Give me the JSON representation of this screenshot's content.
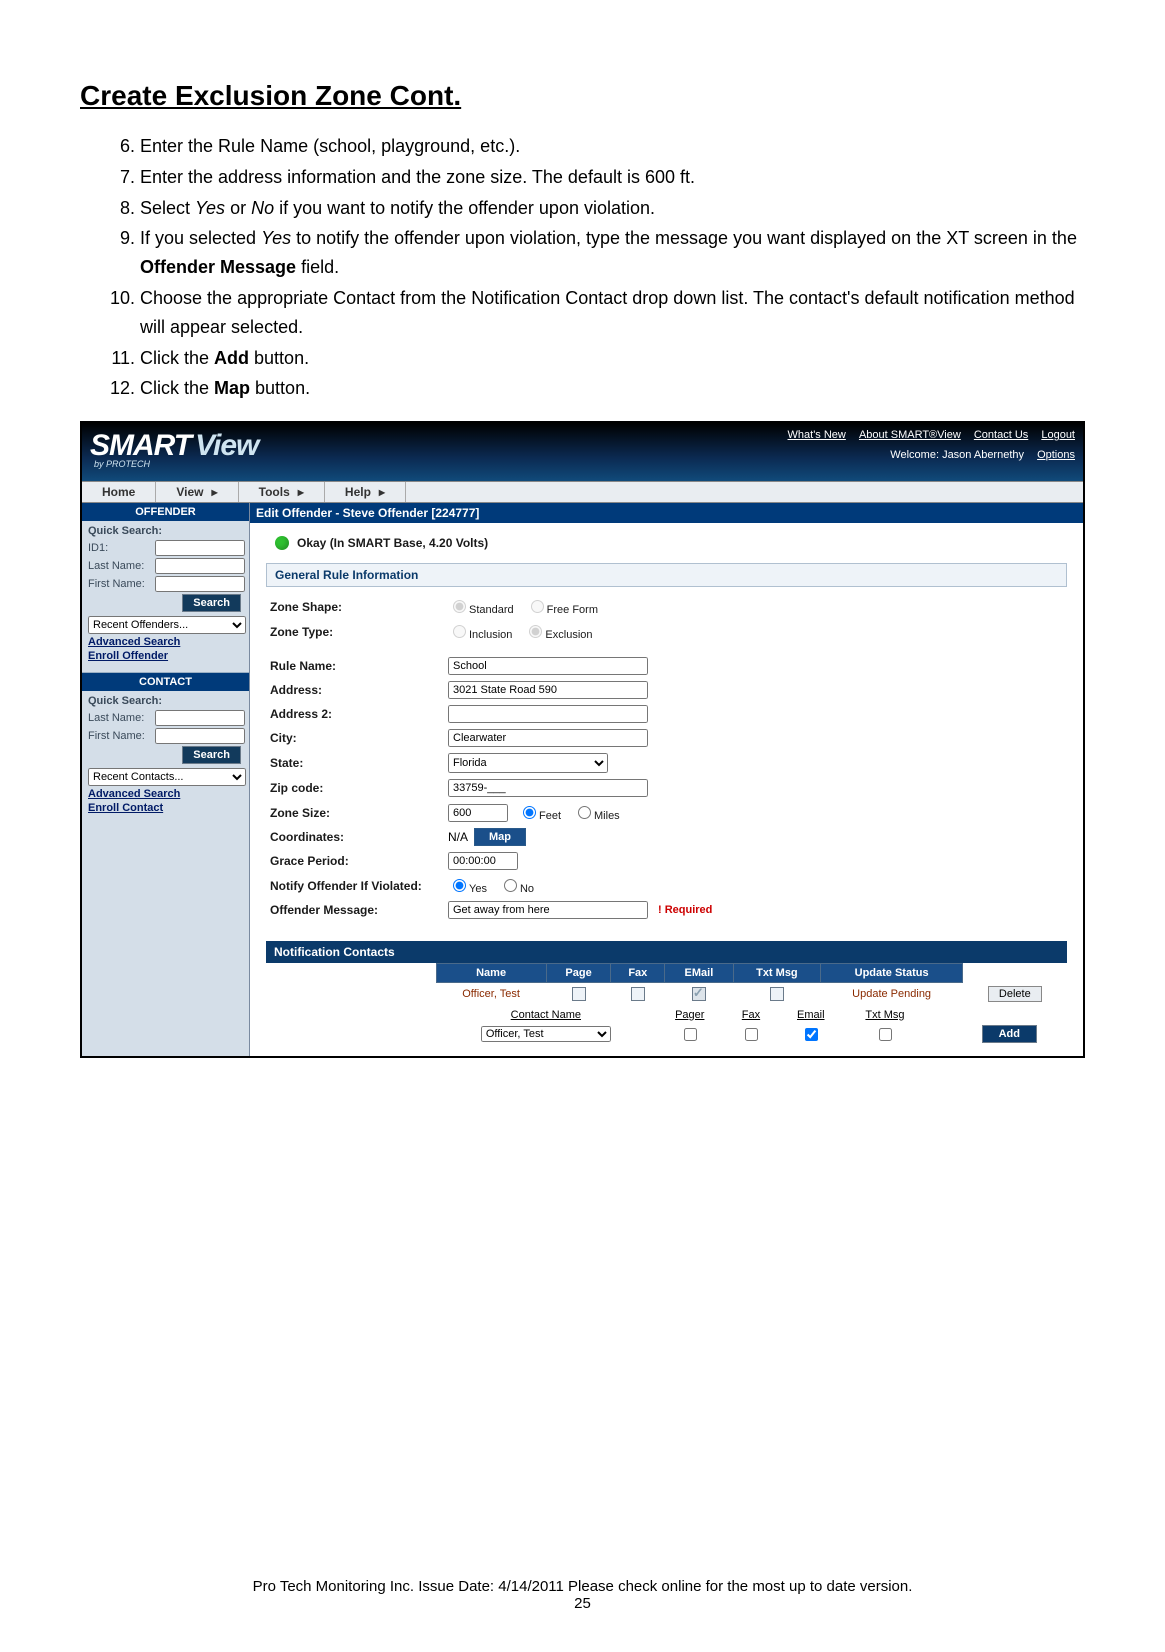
{
  "doc": {
    "title": "Create Exclusion Zone Cont.",
    "steps_start": 6,
    "steps": [
      "Enter the Rule Name (school, playground, etc.).",
      "Enter the address information and the zone size. The default is 600 ft.",
      "Select <i>Yes</i> or <i>No</i> if you want to notify the offender upon violation.",
      "If you selected <i>Yes</i> to notify the offender upon violation, type the message you want displayed on the XT screen in the <b>Offender Message</b> field.",
      "Choose the appropriate Contact from the Notification Contact drop down list. The contact's default notification method will appear selected.",
      "Click the <b>Add</b> button.",
      "Click the <b>Map</b> button."
    ],
    "footer": "Pro Tech Monitoring Inc. Issue Date: 4/14/2011 Please check online for the most up to date version.",
    "page_number": "25"
  },
  "header": {
    "logo1": "SMART",
    "logo2": "View",
    "by": "by PROTECH",
    "links": {
      "whats_new": "What's New",
      "about": "About SMART®View",
      "contact": "Contact Us",
      "logout": "Logout"
    },
    "welcome_label": "Welcome:",
    "welcome_user": "Jason Abernethy",
    "options": "Options"
  },
  "menu": {
    "home": "Home",
    "view": "View",
    "tools": "Tools",
    "help": "Help"
  },
  "sidebar": {
    "offender_head": "OFFENDER",
    "quick_search": "Quick Search:",
    "id1": "ID1:",
    "last_name": "Last Name:",
    "first_name": "First Name:",
    "search_btn": "Search",
    "recent_offenders": "Recent Offenders...",
    "advanced_search": "Advanced Search",
    "enroll_offender": "Enroll Offender",
    "contact_head": "CONTACT",
    "recent_contacts": "Recent Contacts...",
    "enroll_contact": "Enroll Contact"
  },
  "main": {
    "title": "Edit Offender - Steve Offender [224777]",
    "status": "Okay (In SMART Base, 4.20 Volts)",
    "panel_head": "General Rule Information",
    "labels": {
      "zone_shape": "Zone Shape:",
      "zone_type": "Zone Type:",
      "rule_name": "Rule Name:",
      "address": "Address:",
      "address2": "Address 2:",
      "city": "City:",
      "state": "State:",
      "zip": "Zip code:",
      "zone_size": "Zone Size:",
      "coordinates": "Coordinates:",
      "grace_period": "Grace Period:",
      "notify": "Notify Offender If Violated:",
      "offender_message": "Offender Message:"
    },
    "zone_shape": {
      "standard": "Standard",
      "freeform": "Free Form"
    },
    "zone_type": {
      "inclusion": "Inclusion",
      "exclusion": "Exclusion"
    },
    "values": {
      "rule_name": "School",
      "address": "3021 State Road 590",
      "address2": "",
      "city": "Clearwater",
      "state": "Florida",
      "zip": "33759-___",
      "zone_size": "600",
      "coordinates": "N/A",
      "grace_period": "00:00:00",
      "offender_message": "Get away from here"
    },
    "zone_size_units": {
      "feet": "Feet",
      "miles": "Miles"
    },
    "map_btn": "Map",
    "notify_options": {
      "yes": "Yes",
      "no": "No"
    },
    "required": "! Required",
    "notif_head": "Notification Contacts",
    "notif_table": {
      "headers": {
        "name": "Name",
        "page": "Page",
        "fax": "Fax",
        "email": "EMail",
        "txt": "Txt Msg",
        "update": "Update Status"
      },
      "row": {
        "name": "Officer, Test",
        "update_status": "Update Pending",
        "delete": "Delete"
      }
    },
    "notif_add": {
      "headers": {
        "contact": "Contact Name",
        "pager": "Pager",
        "fax": "Fax",
        "email": "Email",
        "txt": "Txt Msg"
      },
      "selected_contact": "Officer, Test",
      "add_btn": "Add"
    }
  }
}
